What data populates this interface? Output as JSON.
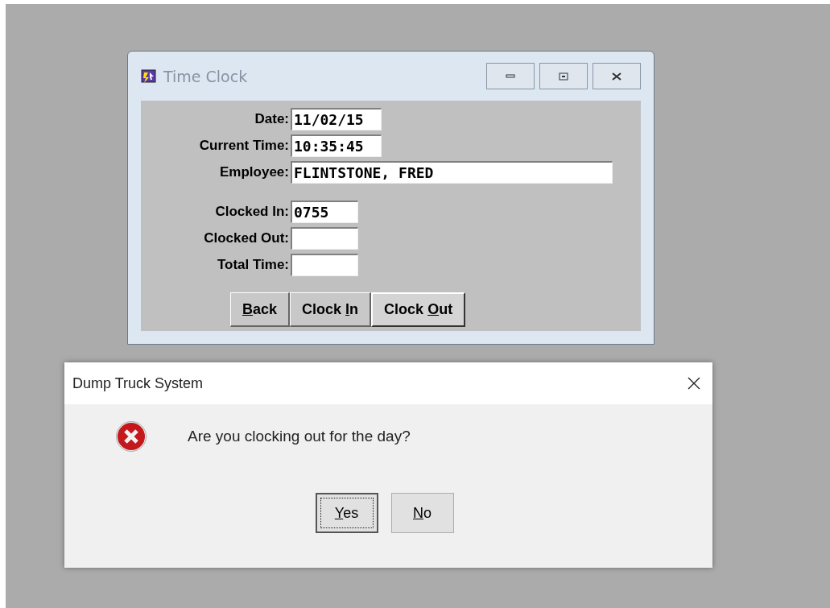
{
  "window": {
    "title": "Time Clock",
    "fields": [
      {
        "label": "Date:",
        "value": "11/02/15",
        "kind": "short"
      },
      {
        "label": "Current Time:",
        "value": "10:35:45",
        "kind": "short"
      },
      {
        "label": "Employee:",
        "value": "FLINTSTONE, FRED",
        "kind": "long"
      }
    ],
    "time_fields": [
      {
        "label": "Clocked In:",
        "value": "0755"
      },
      {
        "label": "Clocked Out:"
      },
      {
        "label": "Total Time:"
      }
    ],
    "buttons": [
      {
        "key": "B",
        "post": "ack",
        "default": false
      },
      {
        "pre": "Clock ",
        "key": "I",
        "post": "n",
        "default": false
      },
      {
        "pre": "Clock ",
        "key": "O",
        "post": "ut",
        "default": true
      }
    ]
  },
  "dialog": {
    "title": "Dump Truck System",
    "message": "Are you clocking out for the day?",
    "buttons": [
      {
        "key": "Y",
        "post": "es",
        "focused": true
      },
      {
        "key": "N",
        "post": "o",
        "focused": false
      }
    ]
  }
}
